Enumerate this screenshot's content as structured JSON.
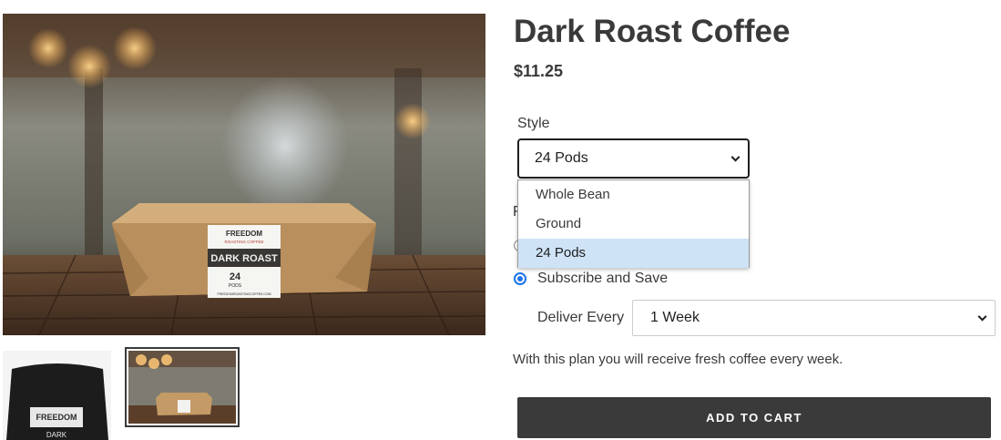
{
  "product": {
    "title": "Dark Roast Coffee",
    "price": "$11.25"
  },
  "gallery": {
    "box_label": {
      "brand": "FREEDOM",
      "sub_brand": "ROASTING COFFEE",
      "name": "DARK ROAST",
      "count": "24",
      "unit": "PODS",
      "site": "FREEDOMROASTINGCOFFEE.COM"
    },
    "bag_label": {
      "brand": "FREEDOM",
      "name": "DARK"
    }
  },
  "style_option": {
    "label": "Style",
    "selected": "24 Pods",
    "options": [
      "Whole Bean",
      "Ground",
      "24 Pods"
    ],
    "chevron_icon": "chevron-down-icon"
  },
  "purchase": {
    "partially_hidden_label": "F",
    "subscribe_label": "Subscribe and Save",
    "deliver_label": "Deliver Every",
    "deliver_value": "1 Week",
    "plan_note": "With this plan you will receive fresh coffee every week."
  },
  "cart": {
    "add_to_cart_label": "ADD TO CART"
  },
  "colors": {
    "text": "#3a3a3a",
    "button_bg": "#3a3a3a",
    "dropdown_highlight": "#cfe3f7",
    "radio_accent": "#1a73e8"
  }
}
